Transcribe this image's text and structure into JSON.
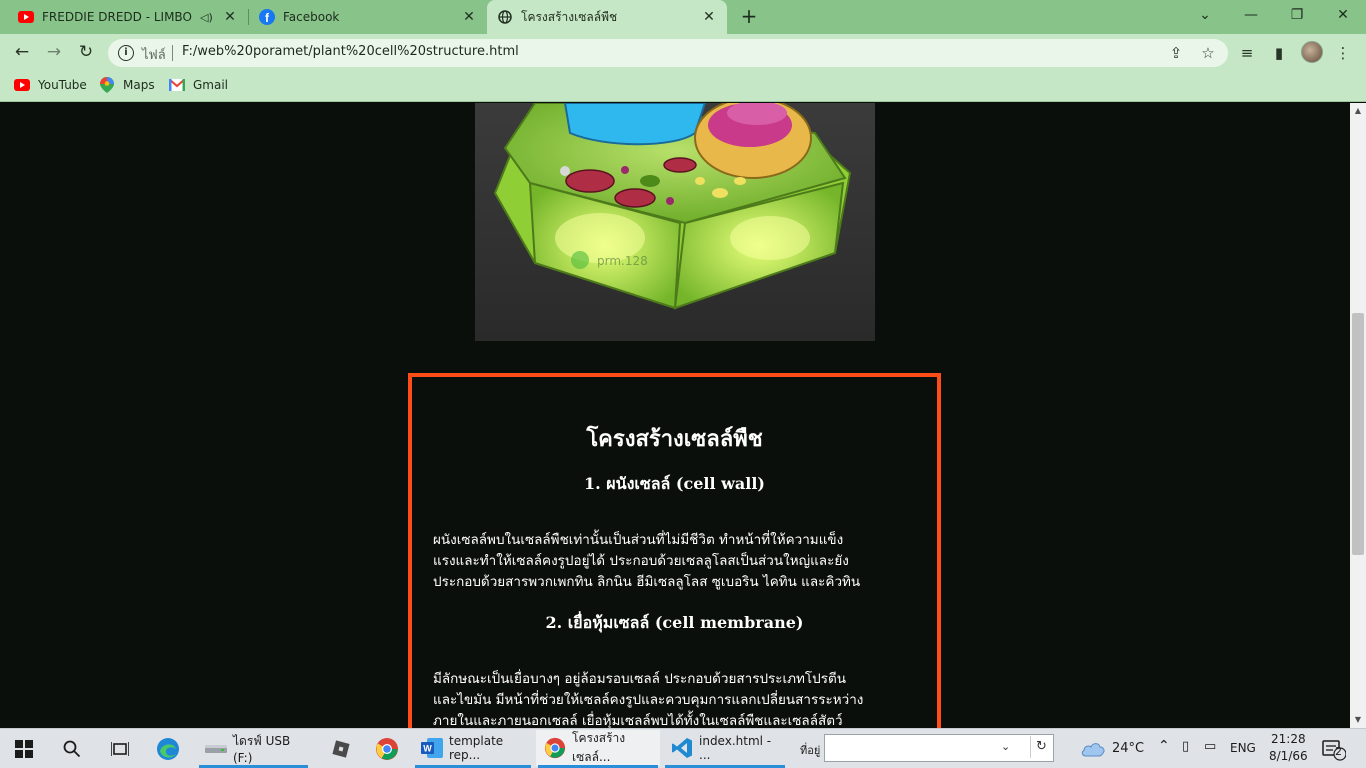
{
  "browser": {
    "tabs": [
      {
        "title": "FREDDIE DREDD - LIMBO (Gl",
        "icon": "youtube-icon",
        "active": false
      },
      {
        "title": "Facebook",
        "icon": "facebook-icon",
        "active": false
      },
      {
        "title": "โครงสร้างเซลล์พืช",
        "icon": "globe-icon",
        "active": true
      }
    ],
    "new_tab": "+",
    "address": {
      "scheme_label": "ไฟล์",
      "url": "F:/web%20poramet/plant%20cell%20structure.html"
    },
    "bookmarks": [
      {
        "label": "YouTube",
        "icon": "youtube-icon"
      },
      {
        "label": "Maps",
        "icon": "maps-icon"
      },
      {
        "label": "Gmail",
        "icon": "gmail-icon"
      }
    ]
  },
  "page": {
    "image_watermark": "prm.128",
    "title": "โครงสร้างเซลล์พืช",
    "sections": [
      {
        "heading": "1. ผนังเซลล์ (cell wall)",
        "lines": [
          "ผนังเซลล์พบในเซลล์พืชเท่านั้นเป็นส่วนที่ไม่มีชีวิต ทำหน้าที่ให้ความแข็ง",
          "แรงและทำให้เซลล์คงรูปอยู่ได้ ประกอบด้วยเซลลูโลสเป็นส่วนใหญ่และยัง",
          "ประกอบด้วยสารพวกเพกทิน ลิกนิน ฮีมิเซลลูโลส ซูเบอริน ไคทิน และคิวทิน"
        ]
      },
      {
        "heading": "2. เยื่อหุ้มเซลล์ (cell membrane)",
        "lines": [
          "มีลักษณะเป็นเยื่อบางๆ อยู่ล้อมรอบเซลล์ ประกอบด้วยสารประเภทโปรตีน",
          "และไขมัน มีหน้าที่ช่วยให้เซลล์คงรูปและควบคุมการแลกเปลี่ยนสารระหว่าง",
          "ภายในและภายนอกเซลล์ เยื่อหุ้มเซลล์พบได้ทั้งในเซลล์พืชและเซลล์สัตว์"
        ]
      }
    ]
  },
  "taskbar": {
    "apps": [
      {
        "label": "ไดรฟ์ USB (F:)",
        "icon": "usb-drive-icon"
      },
      {
        "label": "template rep...",
        "icon": "word-icon"
      },
      {
        "label": "โครงสร้างเซลล์...",
        "icon": "chrome-icon"
      },
      {
        "label": "index.html - ...",
        "icon": "vscode-icon"
      }
    ],
    "address_label": "ที่อยู่",
    "weather": "24°C",
    "language": "ENG",
    "time": "21:28",
    "date": "8/1/66",
    "notification_count": "2"
  }
}
